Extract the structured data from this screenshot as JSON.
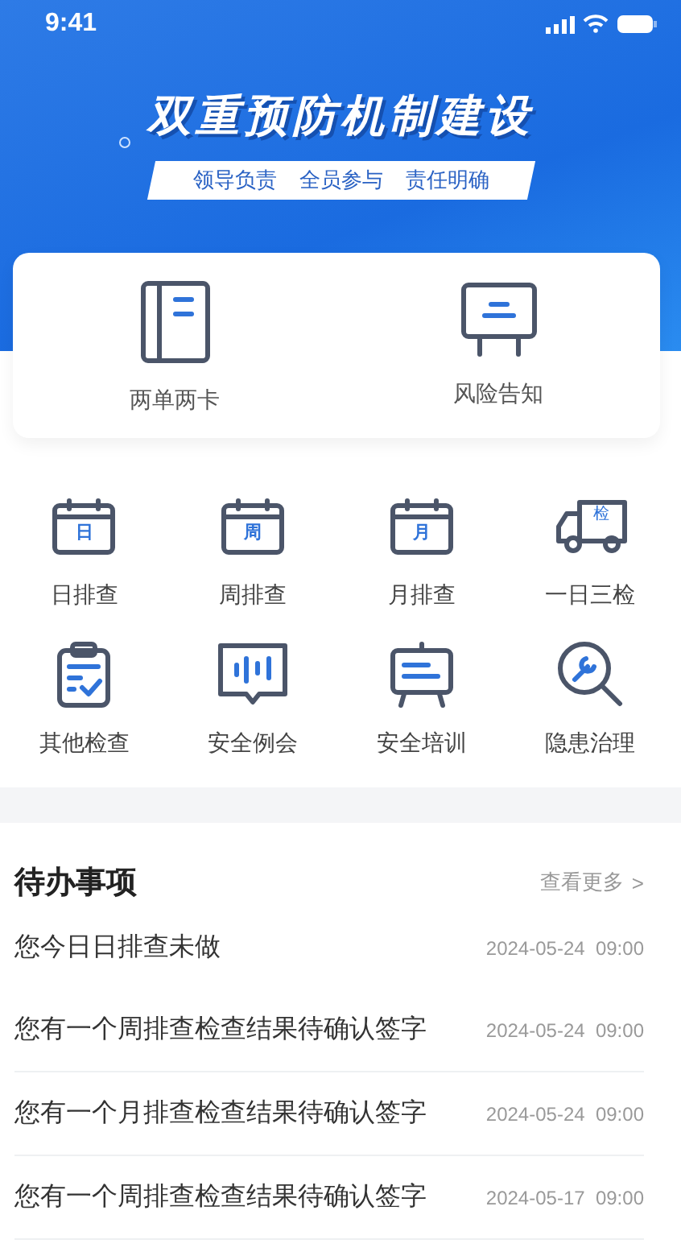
{
  "status_bar": {
    "time": "9:41"
  },
  "banner": {
    "title": "双重预防机制建设",
    "slogans": [
      "领导负责",
      "全员参与",
      "责任明确"
    ]
  },
  "quick_entries": [
    {
      "label": "两单两卡"
    },
    {
      "label": "风险告知"
    }
  ],
  "tools": [
    {
      "label": "日排查",
      "icon_text": "日"
    },
    {
      "label": "周排查",
      "icon_text": "周"
    },
    {
      "label": "月排查",
      "icon_text": "月"
    },
    {
      "label": "一日三检",
      "icon_text": "检"
    },
    {
      "label": "其他检查"
    },
    {
      "label": "安全例会"
    },
    {
      "label": "安全培训"
    },
    {
      "label": "隐患治理"
    }
  ],
  "todo": {
    "title": "待办事项",
    "more": "查看更多",
    "more_icon": ">",
    "items": [
      {
        "text": "您今日日排查未做",
        "time": "2024-05-24  09:00"
      },
      {
        "text": "您有一个周排查检查结果待确认签字",
        "time": "2024-05-24  09:00"
      },
      {
        "text": "您有一个月排查检查结果待确认签字",
        "time": "2024-05-24  09:00"
      },
      {
        "text": "您有一个周排查检查结果待确认签字",
        "time": "2024-05-17  09:00"
      }
    ]
  }
}
